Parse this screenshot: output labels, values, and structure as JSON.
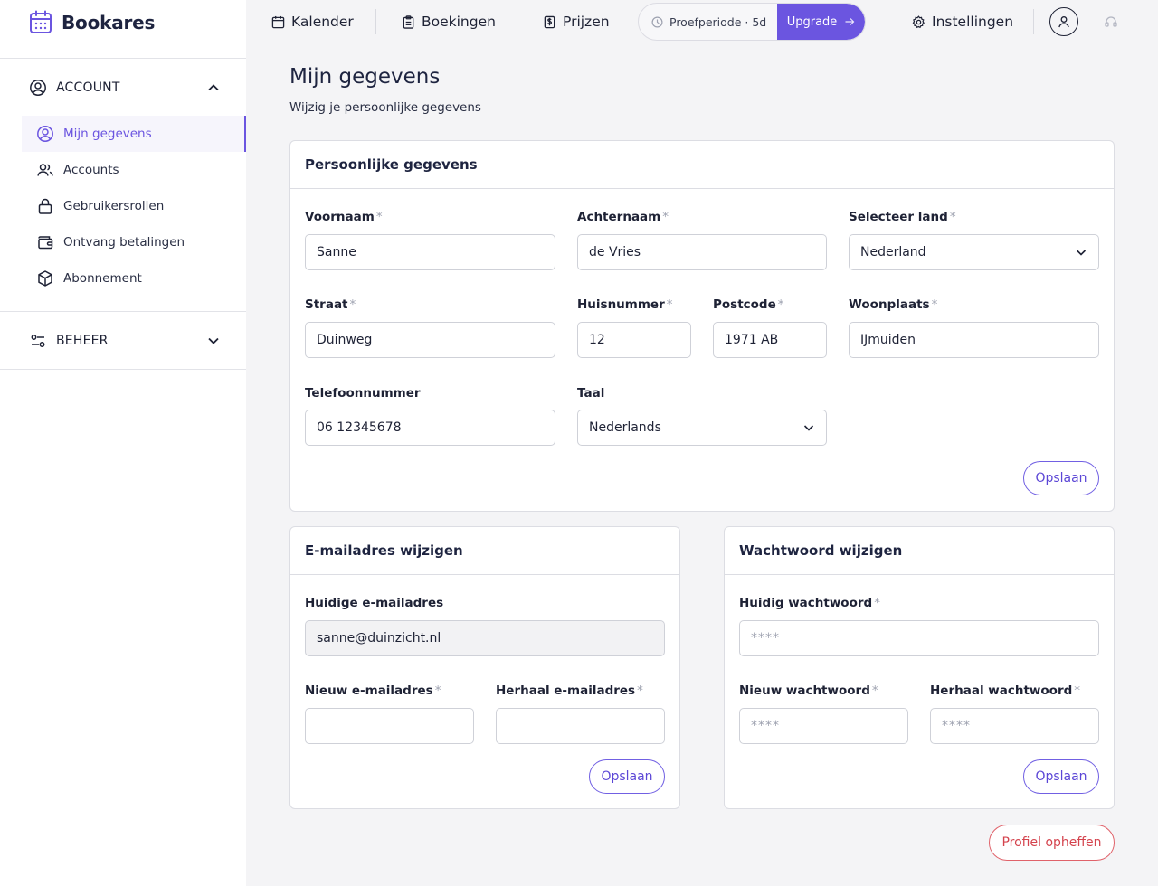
{
  "app": {
    "name": "Bookares"
  },
  "sidebar": {
    "sections": [
      {
        "label": "ACCOUNT",
        "expanded": true,
        "icon": "user-circle-icon"
      },
      {
        "label": "BEHEER",
        "expanded": false,
        "icon": "sliders-icon"
      }
    ],
    "items": [
      {
        "label": "Mijn gegevens",
        "icon": "user-circle-icon",
        "active": true
      },
      {
        "label": "Accounts",
        "icon": "users-icon"
      },
      {
        "label": "Gebruikersrollen",
        "icon": "lock-icon"
      },
      {
        "label": "Ontvang betalingen",
        "icon": "wallet-icon"
      },
      {
        "label": "Abonnement",
        "icon": "box-icon"
      }
    ]
  },
  "topnav": {
    "items": [
      {
        "label": "Kalender",
        "icon": "calendar-icon"
      },
      {
        "label": "Boekingen",
        "icon": "clipboard-icon"
      },
      {
        "label": "Prijzen",
        "icon": "price-icon"
      }
    ],
    "trial": {
      "label": "Proefperiode · 5d",
      "button": "Upgrade"
    },
    "settings": {
      "label": "Instellingen",
      "icon": "gear-icon"
    }
  },
  "page": {
    "title": "Mijn gegevens",
    "subtitle": "Wijzig je persoonlijke gegevens"
  },
  "personal": {
    "title": "Persoonlijke gegevens",
    "fields": {
      "firstname": {
        "label": "Voornaam",
        "value": "Sanne"
      },
      "lastname": {
        "label": "Achternaam",
        "value": "de Vries"
      },
      "country": {
        "label": "Selecteer land",
        "value": "Nederland"
      },
      "street": {
        "label": "Straat",
        "value": "Duinweg"
      },
      "housenumber": {
        "label": "Huisnummer",
        "value": "12"
      },
      "postcode": {
        "label": "Postcode",
        "value": "1971 AB"
      },
      "city": {
        "label": "Woonplaats",
        "value": "IJmuiden"
      },
      "phone": {
        "label": "Telefoonnummer",
        "value": "06 12345678"
      },
      "language": {
        "label": "Taal",
        "value": "Nederlands"
      }
    },
    "save": "Opslaan"
  },
  "email": {
    "title": "E-mailadres wijzigen",
    "current": {
      "label": "Huidige e-mailadres",
      "value": "sanne@duinzicht.nl"
    },
    "new": {
      "label": "Nieuw e-mailadres",
      "value": ""
    },
    "repeat": {
      "label": "Herhaal e-mailadres",
      "value": ""
    },
    "save": "Opslaan"
  },
  "password": {
    "title": "Wachtwoord wijzigen",
    "current": {
      "label": "Huidig wachtwoord",
      "placeholder": "****"
    },
    "new": {
      "label": "Nieuw wachtwoord",
      "placeholder": "****"
    },
    "repeat": {
      "label": "Herhaal wachtwoord",
      "placeholder": "****"
    },
    "save": "Opslaan"
  },
  "required_mark": "*",
  "delete_profile": "Profiel opheffen",
  "colors": {
    "accent": "#6b55e0",
    "danger": "#d4434d",
    "text": "#1e2440",
    "border": "#dcdde3"
  }
}
